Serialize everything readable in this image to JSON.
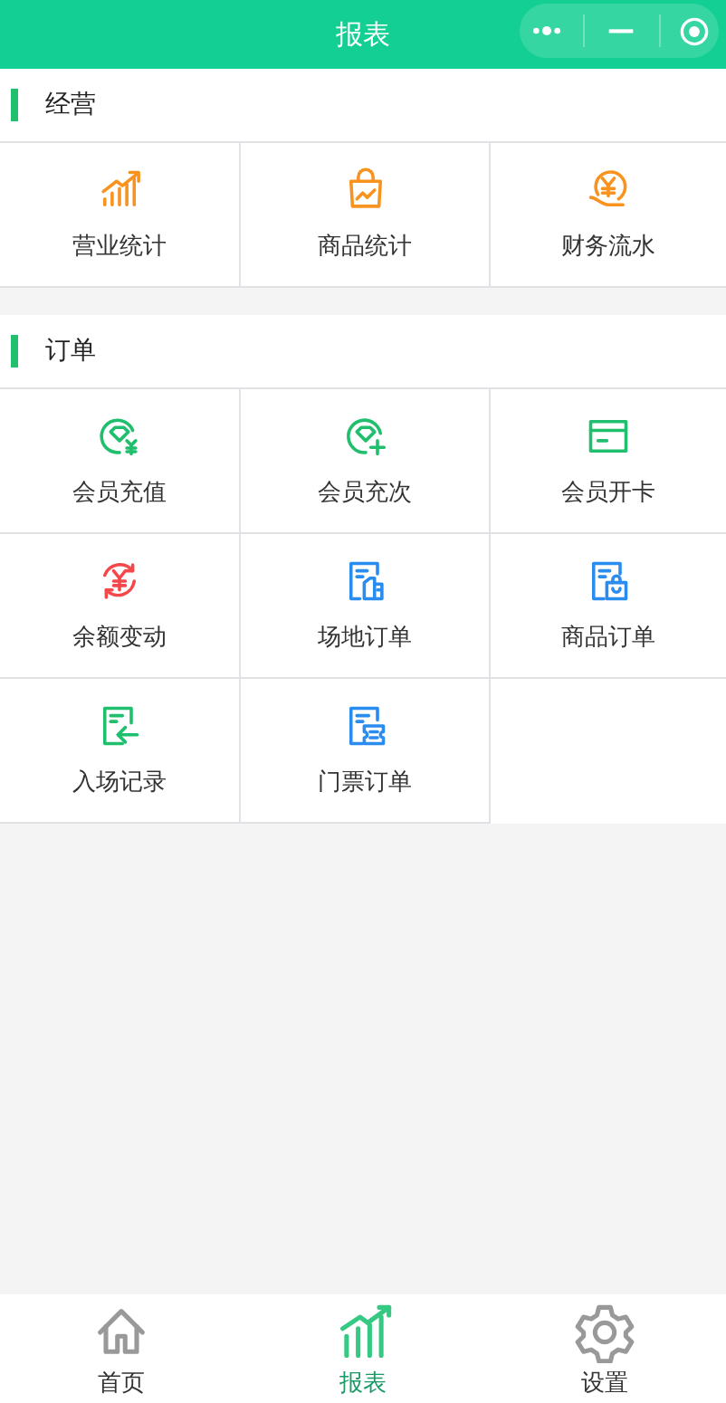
{
  "header": {
    "title": "报表"
  },
  "sections": [
    {
      "title": "经营",
      "items": [
        {
          "label": "营业统计",
          "color": "#f7931e"
        },
        {
          "label": "商品统计",
          "color": "#f7931e"
        },
        {
          "label": "财务流水",
          "color": "#f7931e"
        }
      ]
    },
    {
      "title": "订单",
      "items": [
        {
          "label": "会员充值",
          "color": "#1fbf6e"
        },
        {
          "label": "会员充次",
          "color": "#1fbf6e"
        },
        {
          "label": "会员开卡",
          "color": "#1fbf6e"
        },
        {
          "label": "余额变动",
          "color": "#f5484a"
        },
        {
          "label": "场地订单",
          "color": "#2b8cf0"
        },
        {
          "label": "商品订单",
          "color": "#2b8cf0"
        },
        {
          "label": "入场记录",
          "color": "#1fbf6e"
        },
        {
          "label": "门票订单",
          "color": "#2b8cf0"
        }
      ]
    }
  ],
  "tabbar": [
    {
      "label": "首页",
      "selected": false
    },
    {
      "label": "报表",
      "selected": true
    },
    {
      "label": "设置",
      "selected": false
    }
  ]
}
